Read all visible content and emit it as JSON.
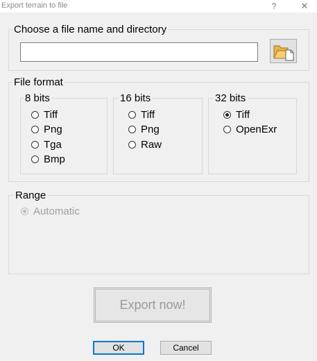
{
  "window": {
    "title": "Export terrain to file",
    "help_glyph": "?",
    "close_glyph": "✕"
  },
  "file_section": {
    "legend": "Choose a file name and directory",
    "path_value": "",
    "browse_icon": "folder-open-icon"
  },
  "format_section": {
    "legend": "File format",
    "groups": [
      {
        "label": "8 bits",
        "options": [
          "Tiff",
          "Png",
          "Tga",
          "Bmp"
        ]
      },
      {
        "label": "16 bits",
        "options": [
          "Tiff",
          "Png",
          "Raw"
        ]
      },
      {
        "label": "32 bits",
        "options": [
          "Tiff",
          "OpenExr"
        ]
      }
    ],
    "selected": "32 bits / Tiff"
  },
  "range_section": {
    "legend": "Range",
    "options": [
      "Automatic"
    ],
    "selected": "Automatic",
    "enabled": false
  },
  "actions": {
    "export_label": "Export now!",
    "export_enabled": false,
    "ok_label": "OK",
    "cancel_label": "Cancel"
  },
  "colors": {
    "dialog_bg": "#f0f0f0",
    "default_button_border": "#0078d7",
    "disabled_text": "#a0a0a0"
  }
}
